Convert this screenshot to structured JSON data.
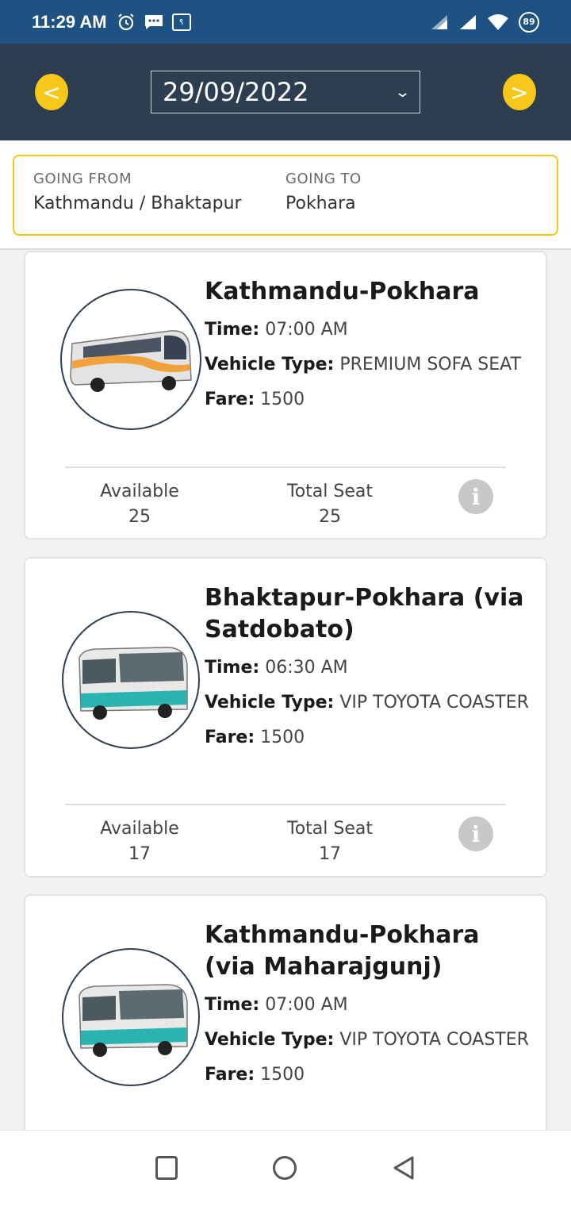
{
  "status_bar": {
    "time": "11:29 AM",
    "battery": "89",
    "extra_icon_text": "९"
  },
  "header": {
    "prev_label": "<",
    "next_label": ">",
    "date": "29/09/2022"
  },
  "route": {
    "from_label": "GOING FROM",
    "from_value": "Kathmandu / Bhaktapur",
    "to_label": "GOING TO",
    "to_value": "Pokhara"
  },
  "trips": [
    {
      "title": "Kathmandu-Pokhara",
      "time_label": "Time:",
      "time": "07:00 AM",
      "vehicle_label": "Vehicle Type:",
      "vehicle": "PREMIUM SOFA SEAT",
      "fare_label": "Fare:",
      "fare": "1500",
      "available_label": "Available",
      "available": "25",
      "total_label": "Total Seat",
      "total": "25",
      "info_label": "i"
    },
    {
      "title": "Bhaktapur-Pokhara (via Satdobato)",
      "time_label": "Time:",
      "time": "06:30 AM",
      "vehicle_label": "Vehicle Type:",
      "vehicle": "VIP TOYOTA COASTER",
      "fare_label": "Fare:",
      "fare": "1500",
      "available_label": "Available",
      "available": "17",
      "total_label": "Total Seat",
      "total": "17",
      "info_label": "i"
    },
    {
      "title": "Kathmandu-Pokhara (via Maharajgunj)",
      "time_label": "Time:",
      "time": "07:00 AM",
      "vehicle_label": "Vehicle Type:",
      "vehicle": "VIP TOYOTA COASTER",
      "fare_label": "Fare:",
      "fare": "1500"
    }
  ],
  "colors": {
    "status_bar": "#1d5283",
    "header": "#2c3e50",
    "accent": "#f7c71a"
  }
}
